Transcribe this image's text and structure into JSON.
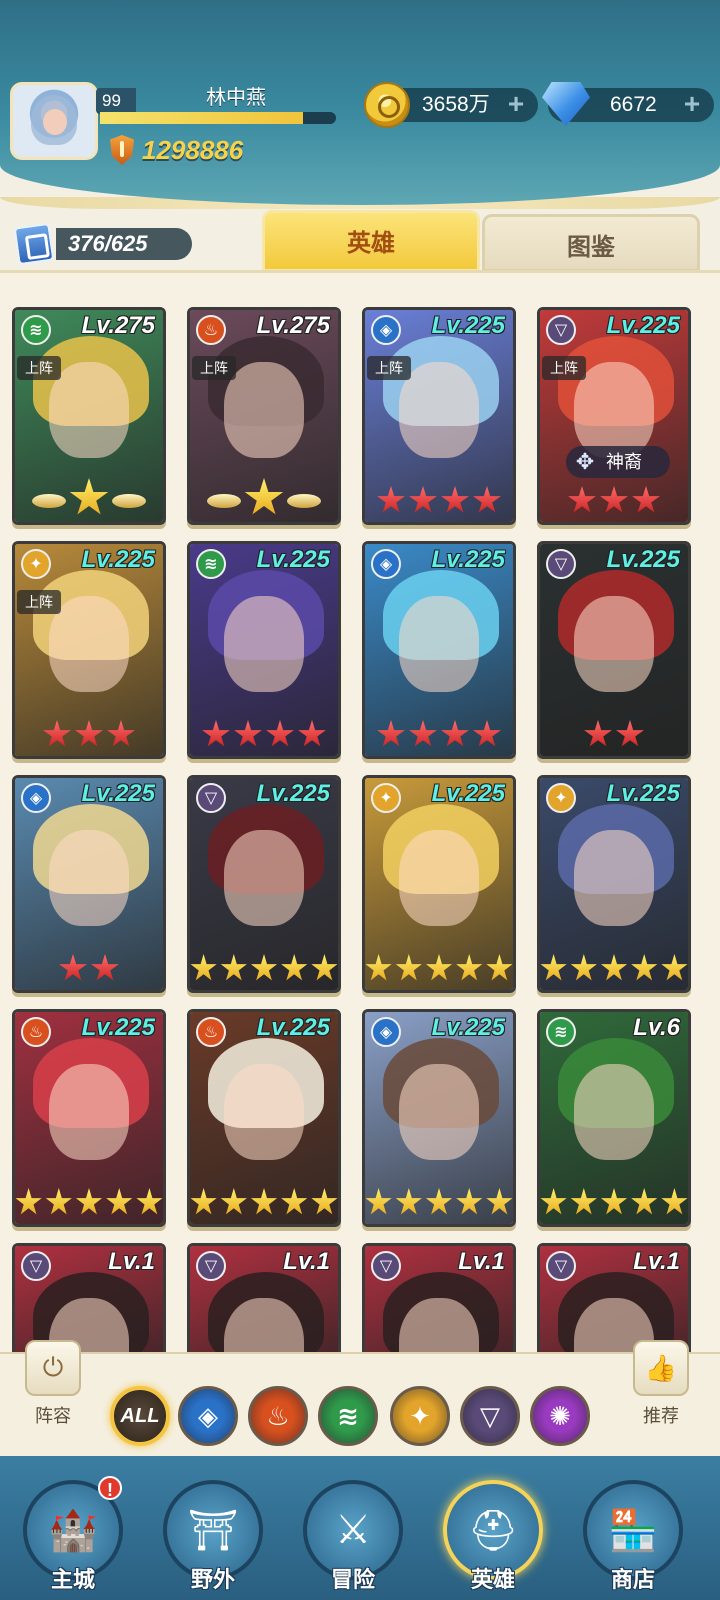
{
  "player": {
    "level": "99",
    "name": "林中燕",
    "exp_fraction": 0.86,
    "power": "1298886"
  },
  "resources": {
    "gold": "3658万",
    "gems": "6672",
    "plus": "+"
  },
  "collection": {
    "count": "376/625"
  },
  "tabs": {
    "heroes": "英雄",
    "codex": "图鉴"
  },
  "labels": {
    "deploy": "上阵",
    "divine": "神裔"
  },
  "heroes": [
    {
      "element": "wind",
      "level": "Lv.275",
      "deploy": true,
      "stars": "wing",
      "color": "#3f8a5a",
      "hair": "#e9c24a"
    },
    {
      "element": "fire",
      "level": "Lv.275",
      "deploy": true,
      "stars": "wing",
      "color": "#6b4a5a",
      "hair": "#3a2a30"
    },
    {
      "element": "water",
      "level": "Lv.225",
      "deploy": true,
      "stars": 4,
      "starColor": "red",
      "color": "#6a7fd8",
      "hair": "#9ad0f0"
    },
    {
      "element": "dark",
      "level": "Lv.225",
      "deploy": true,
      "stars": 3,
      "starColor": "red",
      "color": "#c23a3a",
      "hair": "#e0503a",
      "divine": true
    },
    {
      "element": "light",
      "level": "Lv.225",
      "deploy": true,
      "stars": 3,
      "starColor": "red",
      "color": "#b88a3a",
      "hair": "#f2d27a"
    },
    {
      "element": "wind",
      "level": "Lv.225",
      "deploy": false,
      "stars": 4,
      "starColor": "red",
      "color": "#4a3a8a",
      "hair": "#5a4aa8"
    },
    {
      "element": "water",
      "level": "Lv.225",
      "deploy": false,
      "stars": 4,
      "starColor": "red",
      "color": "#3a8ac8",
      "hair": "#6ad0f0"
    },
    {
      "element": "dark",
      "level": "Lv.225",
      "deploy": false,
      "stars": 2,
      "starColor": "red",
      "color": "#2a3030",
      "hair": "#b02a2a"
    },
    {
      "element": "water",
      "level": "Lv.225",
      "deploy": false,
      "stars": 2,
      "starColor": "red",
      "color": "#5a8ab0",
      "hair": "#f0d890"
    },
    {
      "element": "dark",
      "level": "Lv.225",
      "deploy": false,
      "stars": 5,
      "starColor": "gold",
      "color": "#3a3a48",
      "hair": "#6a1f22"
    },
    {
      "element": "light",
      "level": "Lv.225",
      "deploy": false,
      "stars": 5,
      "starColor": "gold",
      "color": "#c89a3a",
      "hair": "#f2d060"
    },
    {
      "element": "light",
      "level": "Lv.225",
      "deploy": false,
      "stars": 5,
      "starColor": "gold",
      "color": "#3a4a6a",
      "hair": "#5a6aa8"
    },
    {
      "element": "fire",
      "level": "Lv.225",
      "deploy": false,
      "stars": 5,
      "starColor": "gold",
      "color": "#a03040",
      "hair": "#d8404a"
    },
    {
      "element": "fire",
      "level": "Lv.225",
      "deploy": false,
      "stars": 5,
      "starColor": "gold",
      "color": "#6a3a28",
      "hair": "#f4f0e0"
    },
    {
      "element": "water",
      "level": "Lv.225",
      "deploy": false,
      "stars": 5,
      "starColor": "gold",
      "color": "#8aa0c8",
      "hair": "#6a4a3a"
    },
    {
      "element": "wind",
      "level": "Lv.6",
      "deploy": false,
      "stars": 5,
      "starColor": "gold",
      "color": "#2f6a3a",
      "hair": "#3a8a3a"
    },
    {
      "element": "dark",
      "level": "Lv.1",
      "deploy": false,
      "stars": 0,
      "starColor": "red",
      "color": "#b03040",
      "hair": "#2a2020"
    },
    {
      "element": "dark",
      "level": "Lv.1",
      "deploy": false,
      "stars": 0,
      "starColor": "red",
      "color": "#b03040",
      "hair": "#2a2020"
    },
    {
      "element": "dark",
      "level": "Lv.1",
      "deploy": false,
      "stars": 0,
      "starColor": "red",
      "color": "#b03040",
      "hair": "#2a2020"
    },
    {
      "element": "dark",
      "level": "Lv.1",
      "deploy": false,
      "stars": 0,
      "starColor": "red",
      "color": "#b03040",
      "hair": "#2a2020"
    }
  ],
  "element_colors": {
    "wind": "#2f9a4a",
    "fire": "#d8501e",
    "water": "#2a72c8",
    "dark": "#5a4a78",
    "light": "#e2a42a",
    "arcane": "#9a3ac0"
  },
  "filter": {
    "lineup_label": "阵容",
    "recommend_label": "推荐",
    "all_label": "ALL",
    "elements": [
      "water",
      "fire",
      "wind",
      "light",
      "dark",
      "arcane"
    ]
  },
  "nav": [
    {
      "label": "主城",
      "icon": "castle-icon",
      "badge": "!"
    },
    {
      "label": "野外",
      "icon": "portal-icon"
    },
    {
      "label": "冒险",
      "icon": "sword-icon"
    },
    {
      "label": "英雄",
      "icon": "helmet-icon",
      "active": true
    },
    {
      "label": "商店",
      "icon": "shop-icon"
    }
  ]
}
